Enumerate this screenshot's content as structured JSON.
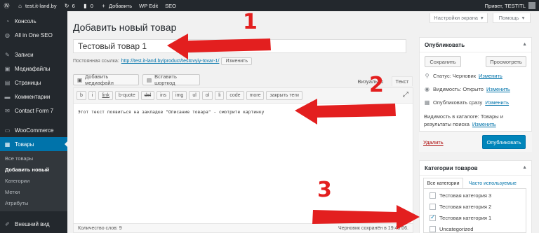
{
  "admin_bar": {
    "site_name": "test.it-land.by",
    "updates_count": "6",
    "comments_count": "0",
    "add_new": "Добавить",
    "wp_edit": "WP Edit",
    "seo": "SEO",
    "greeting": "Привет, TESTITL"
  },
  "sidebar": {
    "items": [
      {
        "label": "Консоль",
        "icon": "dashboard-icon"
      },
      {
        "label": "All in One SEO",
        "icon": "seo-icon"
      },
      {
        "label": "Записи",
        "icon": "pin-icon"
      },
      {
        "label": "Медиафайлы",
        "icon": "media-icon"
      },
      {
        "label": "Страницы",
        "icon": "pages-icon"
      },
      {
        "label": "Комментарии",
        "icon": "comments-icon"
      },
      {
        "label": "Contact Form 7",
        "icon": "mail-icon"
      },
      {
        "label": "WooCommerce",
        "icon": "woocommerce-icon"
      },
      {
        "label": "Товары",
        "icon": "products-icon"
      }
    ],
    "submenu": [
      "Все товары",
      "Добавить новый",
      "Категории",
      "Метки",
      "Атрибуты"
    ],
    "bottom_item": {
      "label": "Внешний вид",
      "icon": "appearance-icon"
    }
  },
  "screen_options": {
    "label": "Настройки экрана"
  },
  "help": {
    "label": "Помощь"
  },
  "page": {
    "title": "Добавить новый товар",
    "product_title_value": "Тестовый товар 1",
    "permalink_label": "Постоянная ссылка:",
    "permalink_url": "http://test.it-land.by/product/testovyiy-tovar-1/",
    "permalink_edit": "Изменить"
  },
  "editor": {
    "add_media": "Добавить медиафайл",
    "insert_shortcode": "Вставить шорткод",
    "tab_visual": "Визуально",
    "tab_text": "Текст",
    "quicktags": [
      "b",
      "i",
      "link",
      "b-quote",
      "del",
      "ins",
      "img",
      "ul",
      "ol",
      "li",
      "code",
      "more",
      "закрыть теги"
    ],
    "content": "Этот текст появиться на закладке \"Описание товара\" - смотрите картинку",
    "word_count": "Количество слов: 9",
    "autosave": "Черновик сохранён в 19:48:06."
  },
  "publish_box": {
    "title": "Опубликовать",
    "save_button": "Сохранить",
    "preview_button": "Просмотреть",
    "status_label": "Статус: Черновик",
    "visibility_label": "Видимость: Открыто",
    "schedule_label": "Опубликовать сразу",
    "edit_link": "Изменить",
    "catalog_line1": "Видимость в каталоге: Товары и",
    "catalog_line2": "результаты поиска",
    "trash_link": "Удалить",
    "publish_button": "Опубликовать"
  },
  "categories_box": {
    "title": "Категории товаров",
    "tab_all": "Все категории",
    "tab_popular": "Часто используемые",
    "items": [
      {
        "label": "Тестовая категория 3",
        "checked": false
      },
      {
        "label": "Тестовая категория 2",
        "checked": false
      },
      {
        "label": "Тестовая категория 1",
        "checked": true
      },
      {
        "label": "Uncategorized",
        "checked": false
      }
    ]
  },
  "annotations": {
    "num1": "1",
    "num2": "2",
    "num3": "3",
    "color": "#e31f1f"
  }
}
